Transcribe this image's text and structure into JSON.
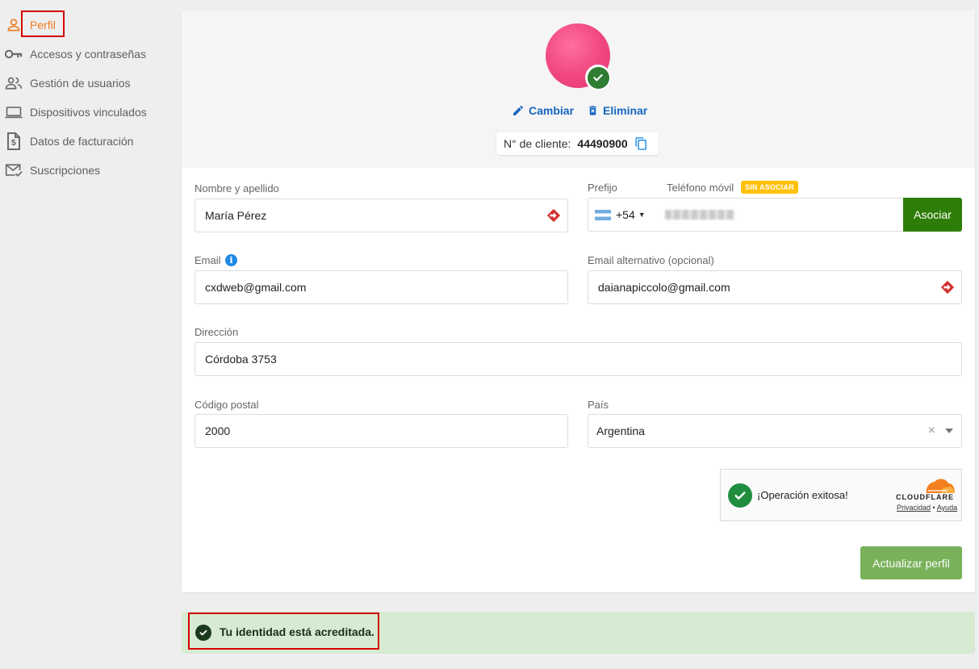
{
  "sidebar": {
    "items": [
      {
        "label": "Perfil",
        "icon": "person-icon",
        "active": true
      },
      {
        "label": "Accesos y contraseñas",
        "icon": "key-icon"
      },
      {
        "label": "Gestión de usuarios",
        "icon": "users-icon"
      },
      {
        "label": "Dispositivos vinculados",
        "icon": "laptop-icon"
      },
      {
        "label": "Datos de facturación",
        "icon": "invoice-icon"
      },
      {
        "label": "Suscripciones",
        "icon": "mail-check-icon"
      }
    ]
  },
  "profile": {
    "change_label": "Cambiar",
    "delete_label": "Eliminar",
    "client_label": "N° de cliente:",
    "client_number": "44490900"
  },
  "form": {
    "name": {
      "label": "Nombre y apellido",
      "value": "María Pérez"
    },
    "prefix": {
      "label": "Prefijo",
      "value": "+54"
    },
    "phone": {
      "label": "Teléfono móvil",
      "badge": "SIN ASOCIAR",
      "button": "Asociar"
    },
    "email": {
      "label": "Email",
      "value": "cxdweb@gmail.com"
    },
    "alt_email": {
      "label": "Email alternativo (opcional)",
      "value": "daianapiccolo@gmail.com"
    },
    "address": {
      "label": "Dirección",
      "value": "Córdoba 3753"
    },
    "postal": {
      "label": "Código postal",
      "value": "2000"
    },
    "country": {
      "label": "País",
      "value": "Argentina"
    }
  },
  "captcha": {
    "message": "¡Operación exitosa!",
    "brand": "CLOUDFLARE",
    "privacy": "Privacidad",
    "separator": "•",
    "help": "Ayuda"
  },
  "update_button": "Actualizar perfil",
  "alert": {
    "text": "Tu identidad está acreditada."
  },
  "colors": {
    "accent": "#f07c22",
    "link": "#1565c0",
    "success": "#2e7d08",
    "alert_bg": "#d7ead2",
    "highlight": "#d50000"
  }
}
